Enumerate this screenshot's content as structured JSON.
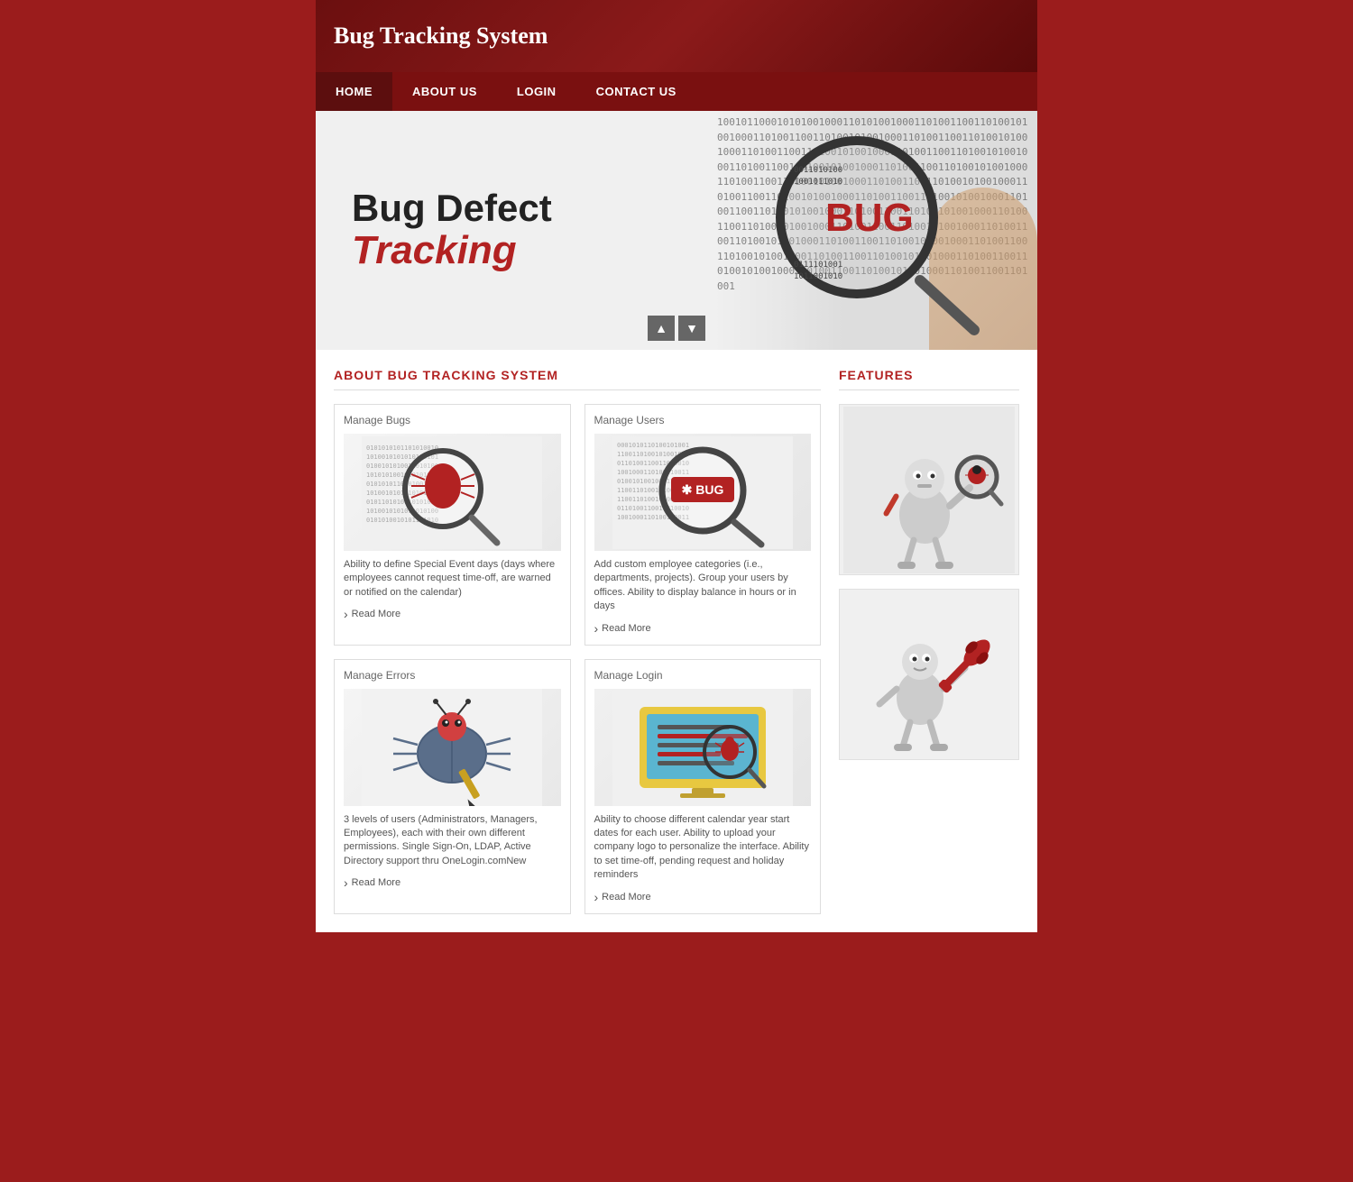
{
  "header": {
    "title": "Bug Tracking System"
  },
  "nav": {
    "items": [
      {
        "label": "HOME",
        "id": "home",
        "active": true
      },
      {
        "label": "ABOUT US",
        "id": "about"
      },
      {
        "label": "LOGIN",
        "id": "login"
      },
      {
        "label": "CONTACT US",
        "id": "contact"
      }
    ]
  },
  "hero": {
    "title_line1": "Bug Defect",
    "title_line2": "Tracking",
    "bug_label": "BUG",
    "binary_text": "10010110001010100100011010100100011010011001101001010010001101001100110100101001000110100110011010010100100011010011001101001010010001101001100110100101001000110100110011010010100100011010011001101001",
    "slider_up": "▲",
    "slider_down": "▼"
  },
  "about_section": {
    "title": "ABOUT BUG TRACKING SYSTEM",
    "cards": [
      {
        "id": "manage-bugs",
        "title": "Manage Bugs",
        "desc": "Ability to define Special Event days (days where employees cannot request time-off, are warned or notified on the calendar)",
        "read_more": "Read More"
      },
      {
        "id": "manage-users",
        "title": "Manage Users",
        "desc": "Add custom employee categories (i.e., departments, projects). Group your users by offices. Ability to display balance in hours or in days",
        "read_more": "Read More"
      },
      {
        "id": "manage-errors",
        "title": "Manage Errors",
        "desc": "3 levels of users (Administrators, Managers, Employees), each with their own different permissions. Single Sign-On, LDAP, Active Directory support thru OneLogin.comNew",
        "read_more": "Read More"
      },
      {
        "id": "manage-login",
        "title": "Manage Login",
        "desc": "Ability to choose different calendar year start dates for each user. Ability to upload your company logo to personalize the interface. Ability to set time-off, pending request and holiday reminders",
        "read_more": "Read More"
      }
    ]
  },
  "features_section": {
    "title": "FEATURES"
  },
  "colors": {
    "accent": "#b22222",
    "nav_bg": "#7a1010",
    "header_bg": "#6b0f0f"
  }
}
